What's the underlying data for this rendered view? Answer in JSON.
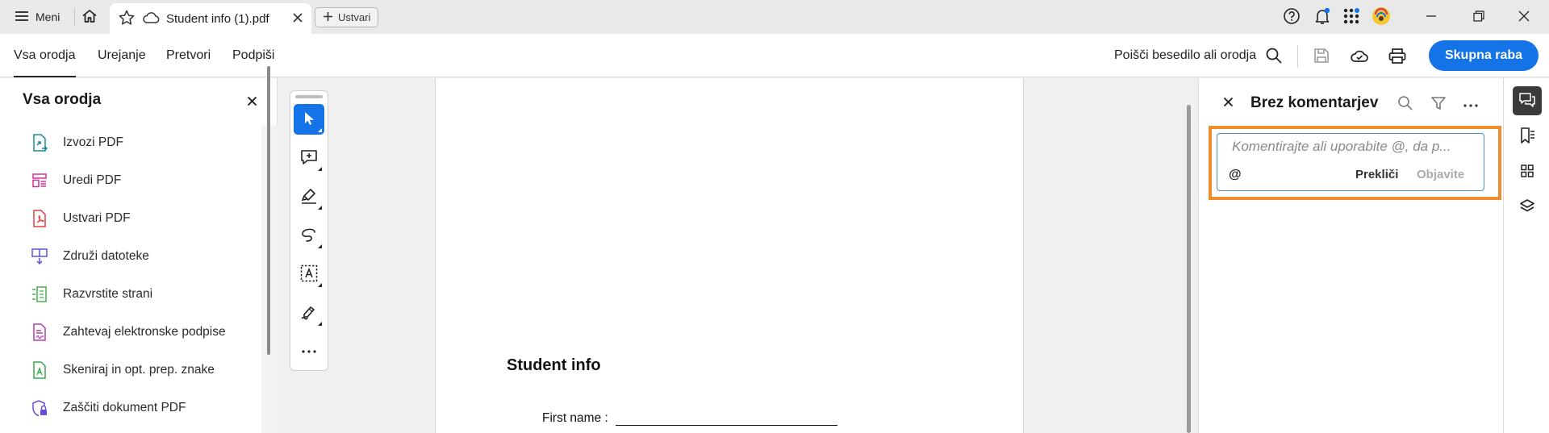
{
  "titlebar": {
    "menu_label": "Meni",
    "tab_title": "Student info (1).pdf",
    "new_tab_label": "Ustvari"
  },
  "toolbar": {
    "tabs": [
      {
        "label": "Vsa orodja",
        "active": true
      },
      {
        "label": "Urejanje",
        "active": false
      },
      {
        "label": "Pretvori",
        "active": false
      },
      {
        "label": "Podpiši",
        "active": false
      }
    ],
    "search_label": "Poišči besedilo ali orodja",
    "share_label": "Skupna raba"
  },
  "left_panel": {
    "title": "Vsa orodja",
    "items": [
      {
        "label": "Izvozi PDF",
        "icon": "export-pdf-icon",
        "color": "#1a8f8a"
      },
      {
        "label": "Uredi PDF",
        "icon": "edit-pdf-icon",
        "color": "#d0309a"
      },
      {
        "label": "Ustvari PDF",
        "icon": "create-pdf-icon",
        "color": "#e0413f"
      },
      {
        "label": "Združi datoteke",
        "icon": "combine-files-icon",
        "color": "#5a55d6"
      },
      {
        "label": "Razvrstite strani",
        "icon": "organize-pages-icon",
        "color": "#42b24a"
      },
      {
        "label": "Zahtevaj elektronske podpise",
        "icon": "request-esign-icon",
        "color": "#b83ab0"
      },
      {
        "label": "Skeniraj in opt. prep. znake",
        "icon": "scan-ocr-icon",
        "color": "#3aa84a"
      },
      {
        "label": "Zaščiti dokument PDF",
        "icon": "protect-pdf-icon",
        "color": "#6a4ad6"
      }
    ]
  },
  "document": {
    "heading": "Student info",
    "field_label": "First name :"
  },
  "comments": {
    "title": "Brez komentarjev",
    "placeholder": "Komentirajte ali uporabite @, da p...",
    "mention_symbol": "@",
    "cancel_label": "Prekliči",
    "post_label": "Objavite"
  },
  "colors": {
    "accent": "#1473e6",
    "highlight": "#f08c2c"
  }
}
